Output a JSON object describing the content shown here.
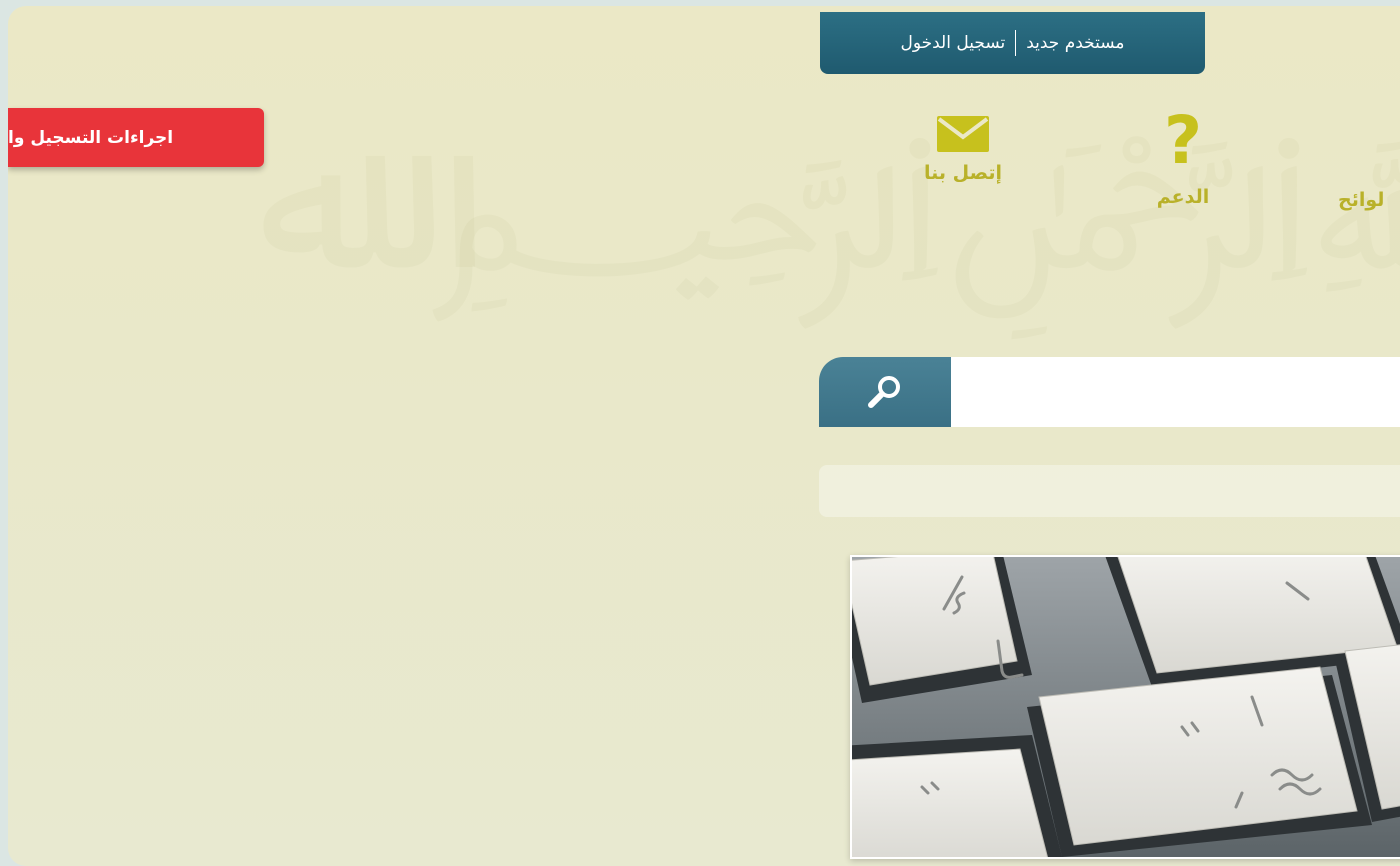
{
  "header": {
    "new_user": "مستخدم جديد",
    "login": "تسجيل الدخول"
  },
  "banner": {
    "register_label": "اجراءات التسجيل وا"
  },
  "nav": {
    "contact_label": "إتصل بنا",
    "support_label": "الدعم",
    "rules_label": "لوائح",
    "support_glyph": "?"
  },
  "search": {
    "value": "",
    "placeholder": ""
  },
  "colors": {
    "accent_teal": "#1f5a6f",
    "register_red": "#e8343a",
    "nav_olive": "#b9b12a",
    "background": "#ebe8c6"
  },
  "icons": {
    "contact": "envelope-icon",
    "support": "question-mark-icon",
    "search": "magnifier-icon"
  }
}
